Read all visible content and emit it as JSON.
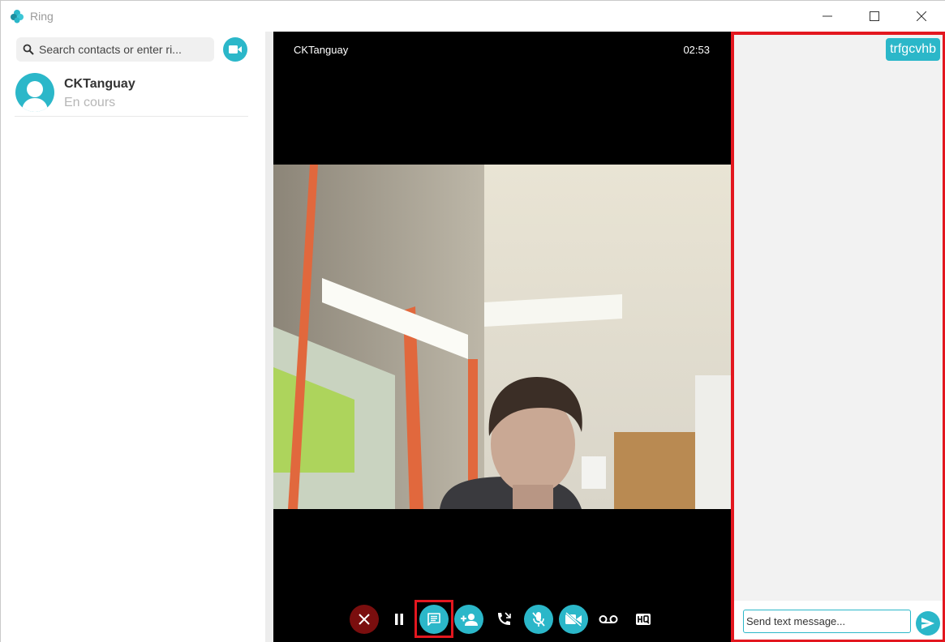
{
  "app": {
    "title": "Ring"
  },
  "sidebar": {
    "search": {
      "placeholder": "Search contacts or enter ri..."
    },
    "video_call_icon": "video-camera-icon",
    "contacts": [
      {
        "name": "CKTanguay",
        "status": "En cours"
      }
    ]
  },
  "call": {
    "peer_name": "CKTanguay",
    "timer": "02:53",
    "controls": [
      {
        "name": "hangup",
        "icon": "close-icon"
      },
      {
        "name": "hold",
        "icon": "pause-icon"
      },
      {
        "name": "chat",
        "icon": "chat-icon"
      },
      {
        "name": "add-participant",
        "icon": "person-add-icon"
      },
      {
        "name": "transfer",
        "icon": "phone-forward-icon"
      },
      {
        "name": "mute",
        "icon": "mic-off-icon"
      },
      {
        "name": "video-off",
        "icon": "videocam-off-icon"
      },
      {
        "name": "record",
        "icon": "voicemail-icon"
      },
      {
        "name": "quality",
        "icon": "hq-icon"
      }
    ]
  },
  "chat": {
    "messages": [
      {
        "text": "trfgcvhb",
        "direction": "outgoing"
      }
    ],
    "input_placeholder": "Send text message..."
  },
  "colors": {
    "accent": "#2bb7c9",
    "hangup": "#7a0e0e",
    "highlight": "#e3171f"
  }
}
